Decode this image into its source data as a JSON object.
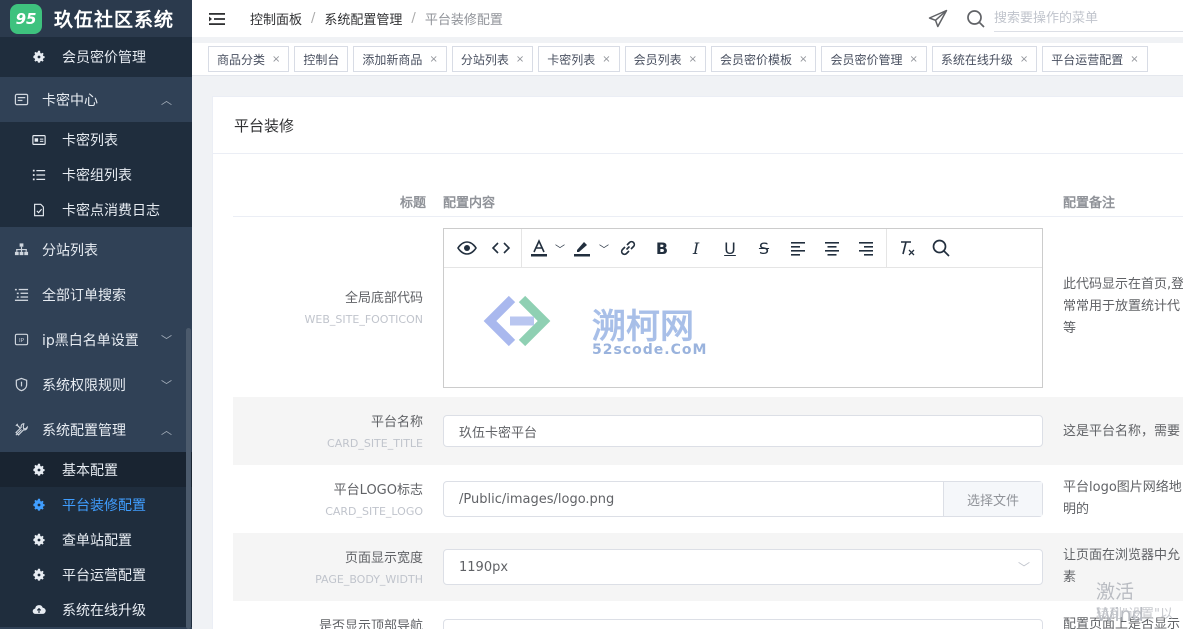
{
  "brand": {
    "logo_text": "95",
    "title": "玖伍社区系统"
  },
  "sidebar": {
    "items": [
      {
        "type": "sub",
        "icon": "gear-icon",
        "label": "会员密价管理"
      },
      {
        "type": "group",
        "icon": "card-icon",
        "label": "卡密中心",
        "expanded": true
      },
      {
        "type": "sub",
        "icon": "card-list-icon",
        "label": "卡密列表"
      },
      {
        "type": "sub",
        "icon": "list-icon",
        "label": "卡密组列表"
      },
      {
        "type": "sub",
        "icon": "log-icon",
        "label": "卡密点消费日志"
      },
      {
        "type": "group",
        "icon": "sitemap-icon",
        "label": "分站列表"
      },
      {
        "type": "group",
        "icon": "order-list-icon",
        "label": "全部订单搜索"
      },
      {
        "type": "group",
        "icon": "ip-icon",
        "label": "ip黑白名单设置",
        "expanded": false
      },
      {
        "type": "group",
        "icon": "shield-icon",
        "label": "系统权限规则",
        "expanded": false
      },
      {
        "type": "group",
        "icon": "tools-icon",
        "label": "系统配置管理",
        "expanded": true
      },
      {
        "type": "sub",
        "icon": "gear-icon",
        "label": "基本配置"
      },
      {
        "type": "sub",
        "icon": "gear-icon",
        "label": "平台装修配置",
        "active": true
      },
      {
        "type": "sub",
        "icon": "gear-icon",
        "label": "查单站配置"
      },
      {
        "type": "sub",
        "icon": "gear-icon",
        "label": "平台运营配置"
      },
      {
        "type": "sub",
        "icon": "cloud-upload-icon",
        "label": "系统在线升级"
      }
    ]
  },
  "header": {
    "breadcrumb": [
      "控制面板",
      "系统配置管理",
      "平台装修配置"
    ],
    "search_placeholder": "搜索要操作的菜单"
  },
  "tags": [
    "商品分类",
    "控制台",
    "添加新商品",
    "分站列表",
    "卡密列表",
    "会员列表",
    "会员密价模板",
    "会员密价管理",
    "系统在线升级",
    "平台运营配置"
  ],
  "card": {
    "title": "平台装修",
    "columns": {
      "label": "标题",
      "content": "配置内容",
      "note": "配置备注"
    },
    "editor_watermark": {
      "title": "溯柯网",
      "sub": "52scode.CoM"
    },
    "rows": [
      {
        "label": "全局底部代码",
        "key": "WEB_SITE_FOOTICON",
        "note": [
          "此代码显示在首页,登",
          "常常用于放置统计代",
          "等"
        ]
      },
      {
        "label": "平台名称",
        "key": "CARD_SITE_TITLE",
        "value": "玖伍卡密平台",
        "note": [
          "这是平台名称，需要"
        ]
      },
      {
        "label": "平台LOGO标志",
        "key": "CARD_SITE_LOGO",
        "value": "/Public/images/logo.png",
        "button": "选择文件",
        "note": [
          "平台logo图片网络地",
          "明的"
        ]
      },
      {
        "label": "页面显示宽度",
        "key": "PAGE_BODY_WIDTH",
        "value": "1190px",
        "note": [
          "让页面在浏览器中允",
          "素"
        ]
      },
      {
        "label": "是否显示顶部导航",
        "note": [
          "配置页面上是否显示"
        ]
      }
    ]
  },
  "windows_watermark": {
    "line1": "激活 Wind",
    "line2": "转到\"设置\"以"
  }
}
